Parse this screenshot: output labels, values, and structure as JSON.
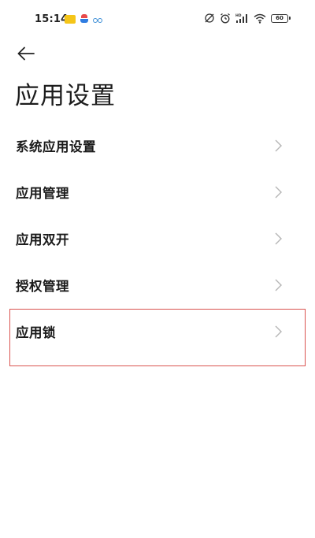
{
  "status_bar": {
    "time": "15:14",
    "battery_level": "60",
    "notification_icons": [
      "app-badge-icon",
      "app-notification-icon",
      "bike-icon"
    ],
    "system_icons": [
      "rotation-lock-icon",
      "alarm-icon",
      "hd-signal-icon",
      "wifi-icon",
      "battery-icon"
    ]
  },
  "header": {
    "back_icon": "arrow-left-icon",
    "title": "应用设置"
  },
  "items": [
    {
      "label": "系统应用设置"
    },
    {
      "label": "应用管理"
    },
    {
      "label": "应用双开"
    },
    {
      "label": "授权管理"
    },
    {
      "label": "应用锁"
    }
  ],
  "colors": {
    "highlight_border": "#d9534f",
    "notification_badge": "#f5c518"
  }
}
